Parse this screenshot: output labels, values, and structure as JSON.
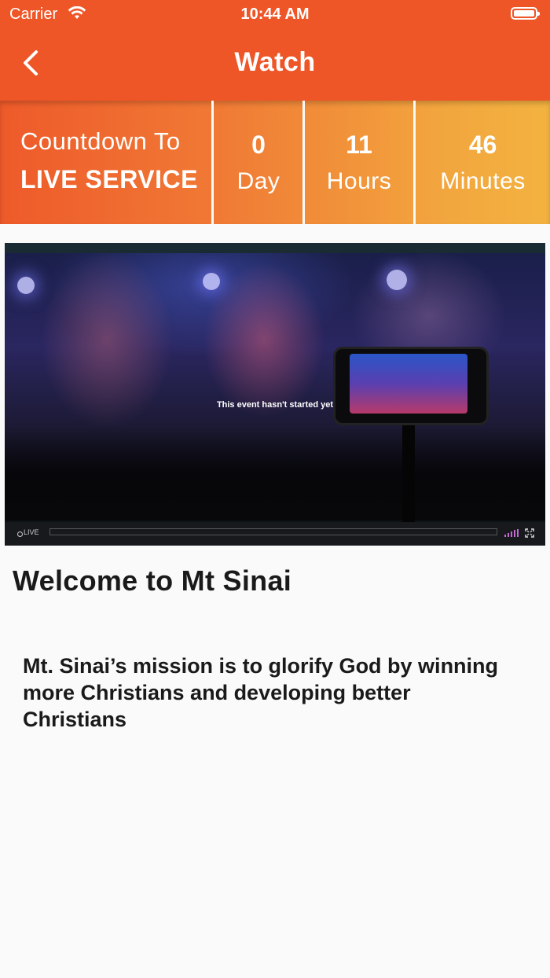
{
  "status_bar": {
    "carrier": "Carrier",
    "time": "10:44 AM"
  },
  "nav": {
    "title": "Watch",
    "back_icon": "chevron-left-icon"
  },
  "countdown": {
    "line1": "Countdown To",
    "line2": "LIVE SERVICE",
    "days": {
      "value": "0",
      "unit": "Day"
    },
    "hours": {
      "value": "11",
      "unit": "Hours"
    },
    "minutes": {
      "value": "46",
      "unit": "Minutes"
    },
    "gradient_start": "#ee5a2a",
    "gradient_end": "#f3b340"
  },
  "video": {
    "message": "This event hasn't started yet",
    "live_label": "LIVE",
    "signal_color": "#c26ad0"
  },
  "content": {
    "heading": "Welcome to Mt Sinai",
    "mission": "Mt. Sinai’s mission is to glorify God by winning more Christians and developing better Christians"
  },
  "colors": {
    "header": "#ee5527",
    "background": "#fafafa",
    "text": "#1a1a1a"
  }
}
